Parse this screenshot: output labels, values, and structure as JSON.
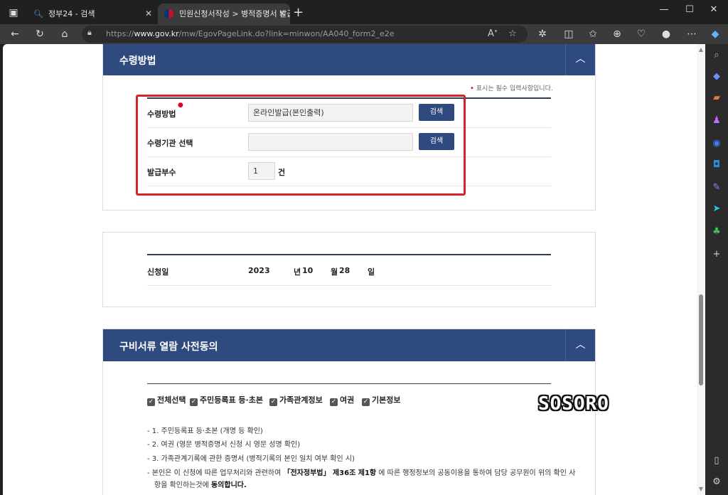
{
  "browser": {
    "tabs": [
      {
        "title": "정부24 - 검색",
        "favicon": "search-icon"
      },
      {
        "title": "민원신청서작성 > 병적증명서 발급",
        "favicon": "gov-emblem-icon"
      }
    ],
    "url_prefix": "https://",
    "url_domain": "www.gov.kr",
    "url_path": "/mw/EgovPageLink.do?link=minwon/AA040_form2_e2e"
  },
  "receive_section": {
    "title": "수령방법",
    "required_note": "표시는 필수 입력사항입니다.",
    "rows": [
      {
        "label": "수령방법",
        "required": true,
        "value": "온라인발급(본인출력)",
        "button": "검색"
      },
      {
        "label": "수령기관 선택",
        "required": false,
        "value": "",
        "button": "검색"
      },
      {
        "label": "발급부수",
        "required": false,
        "value": "1",
        "unit": "건"
      }
    ]
  },
  "date_section": {
    "label": "신청일",
    "year": "2023",
    "year_unit": "년",
    "month": "10",
    "month_unit": "월",
    "day": "28",
    "day_unit": "일"
  },
  "consent_section": {
    "title": "구비서류 열람 사전동의",
    "checkboxes": [
      "전체선택",
      "주민등록표 등·초본",
      "가족관계정보",
      "여권",
      "기본정보"
    ],
    "items": [
      "- 1. 주민등록표 등·초본 (개명 등 확인)",
      "- 2. 여권 (영문 병적증명서 신청 시 영문 성명 확인)",
      "- 3. 가족관계기록에 관한 증명서 (병적기록의 본인 일치 여부 확인 시)"
    ],
    "notice_pre": "- 본인은 이 신청에 따른 업무처리와 관련하여 ",
    "notice_law": "「전자정부법」 제36조 제1항",
    "notice_post": " 에 따른 행정정보의 공동이용을 통하여 담당 공무원이 위의 확인 사",
    "notice_line2_pre": "항을 확인하는것에 ",
    "notice_line2_bold": "동의합니다."
  },
  "watermark": "SOSORO",
  "colors": {
    "header": "#2f4a7e",
    "highlight": "#d6232b",
    "required": "#e0002a"
  }
}
